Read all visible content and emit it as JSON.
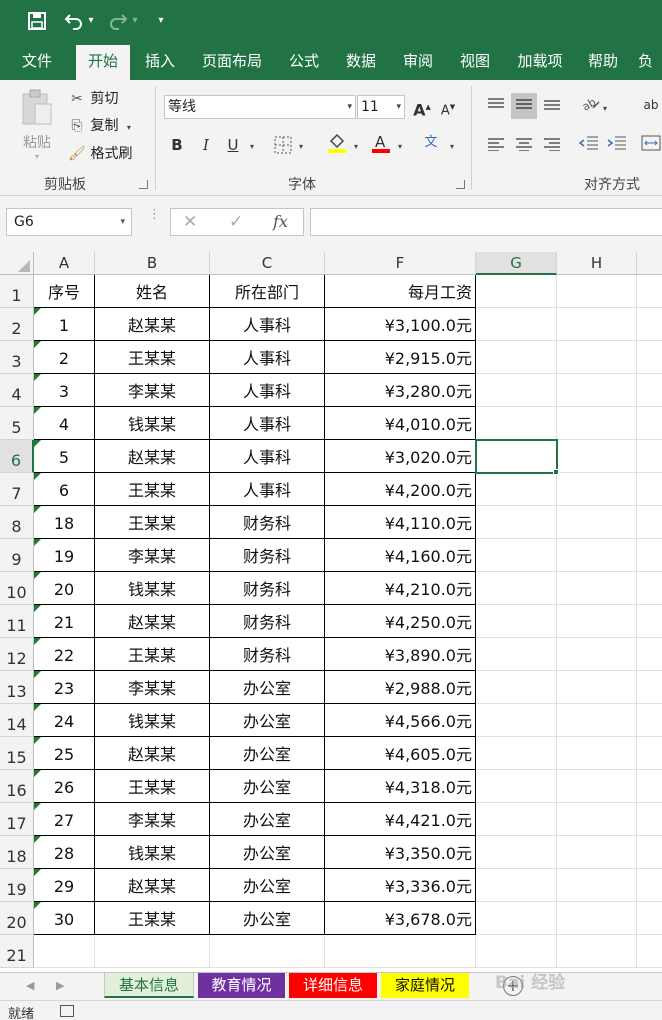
{
  "colors": {
    "brand": "#217346",
    "tab_purple": "#7030a0",
    "tab_red": "#ff0000",
    "tab_yellow": "#ffff00",
    "tab_active_bg": "#e2efda"
  },
  "ribbon_tabs": [
    "文件",
    "开始",
    "插入",
    "页面布局",
    "公式",
    "数据",
    "审阅",
    "视图",
    "加载项",
    "帮助",
    "负"
  ],
  "ribbon": {
    "clipboard": {
      "paste": "粘贴",
      "cut": "剪切",
      "copy": "复制",
      "format_painter": "格式刷",
      "label": "剪贴板"
    },
    "font": {
      "name": "等线",
      "size": "11",
      "bold": "B",
      "italic": "I",
      "underline": "U",
      "grow": "A",
      "shrink": "A",
      "phonetic": "文",
      "label": "字体"
    },
    "alignment": {
      "label": "对齐方式"
    }
  },
  "formula_bar": {
    "name_box": "G6",
    "cancel_icon": "x-icon",
    "enter_icon": "check-icon",
    "fx": "fx",
    "formula": ""
  },
  "grid": {
    "columns": [
      "A",
      "B",
      "C",
      "F",
      "G",
      "H"
    ],
    "selected_column": "G",
    "selected_row": 6,
    "header": [
      "序号",
      "姓名",
      "所在部门",
      "每月工资"
    ],
    "rows": [
      [
        "1",
        "赵某某",
        "人事科",
        "¥3,100.0元"
      ],
      [
        "2",
        "王某某",
        "人事科",
        "¥2,915.0元"
      ],
      [
        "3",
        "李某某",
        "人事科",
        "¥3,280.0元"
      ],
      [
        "4",
        "钱某某",
        "人事科",
        "¥4,010.0元"
      ],
      [
        "5",
        "赵某某",
        "人事科",
        "¥3,020.0元"
      ],
      [
        "6",
        "王某某",
        "人事科",
        "¥4,200.0元"
      ],
      [
        "18",
        "王某某",
        "财务科",
        "¥4,110.0元"
      ],
      [
        "19",
        "李某某",
        "财务科",
        "¥4,160.0元"
      ],
      [
        "20",
        "钱某某",
        "财务科",
        "¥4,210.0元"
      ],
      [
        "21",
        "赵某某",
        "财务科",
        "¥4,250.0元"
      ],
      [
        "22",
        "王某某",
        "财务科",
        "¥3,890.0元"
      ],
      [
        "23",
        "李某某",
        "办公室",
        "¥2,988.0元"
      ],
      [
        "24",
        "钱某某",
        "办公室",
        "¥4,566.0元"
      ],
      [
        "25",
        "赵某某",
        "办公室",
        "¥4,605.0元"
      ],
      [
        "26",
        "王某某",
        "办公室",
        "¥4,318.0元"
      ],
      [
        "27",
        "李某某",
        "办公室",
        "¥4,421.0元"
      ],
      [
        "28",
        "钱某某",
        "办公室",
        "¥3,350.0元"
      ],
      [
        "29",
        "赵某某",
        "办公室",
        "¥3,336.0元"
      ],
      [
        "30",
        "王某某",
        "办公室",
        "¥3,678.0元"
      ]
    ],
    "row_numbers": [
      "1",
      "2",
      "3",
      "4",
      "5",
      "6",
      "7",
      "8",
      "9",
      "10",
      "11",
      "12",
      "13",
      "14",
      "15",
      "16",
      "17",
      "18",
      "19",
      "20",
      "21"
    ]
  },
  "sheet_tabs": [
    {
      "label": "基本信息",
      "active": true,
      "color": "#e2efda",
      "text_color": "#217346"
    },
    {
      "label": "教育情况",
      "active": false,
      "color": "#7030a0",
      "text_color": "#ffffff"
    },
    {
      "label": "详细信息",
      "active": false,
      "color": "#ff0000",
      "text_color": "#ffffff"
    },
    {
      "label": "家庭情况",
      "active": false,
      "color": "#ffff00",
      "text_color": "#111111"
    }
  ],
  "status": {
    "text": "就绪"
  },
  "watermark": "Bai 经验"
}
